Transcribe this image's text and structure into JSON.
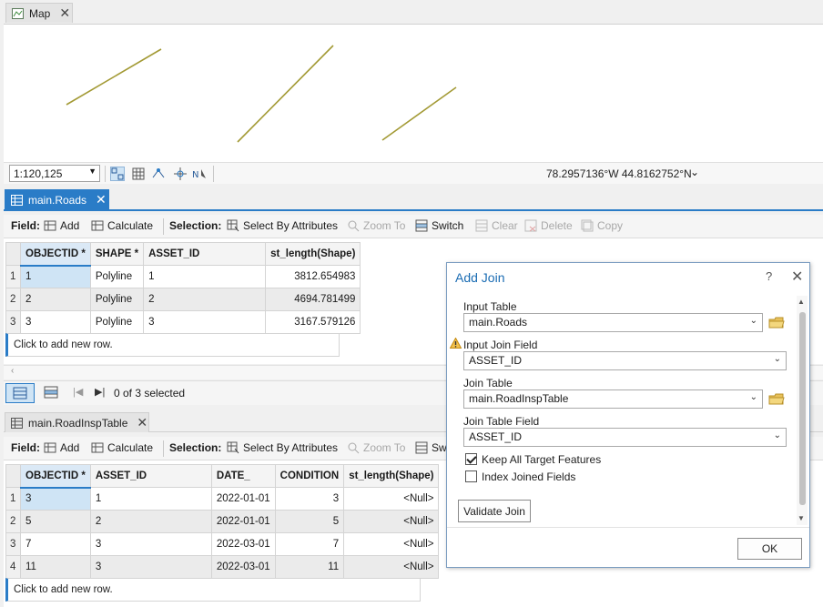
{
  "map_tab": {
    "label": "Map"
  },
  "map_status": {
    "scale": "1:120,125",
    "coordinates": "78.2957136°W 44.8162752°N"
  },
  "roads_tab": {
    "label": "main.Roads"
  },
  "insp_tab": {
    "label": "main.RoadInspTable"
  },
  "toolbar": {
    "field_label": "Field:",
    "add": "Add",
    "calculate": "Calculate",
    "selection_label": "Selection:",
    "select_by_attributes": "Select By Attributes",
    "zoom_to": "Zoom To",
    "switch": "Switch",
    "clear": "Clear",
    "delete": "Delete",
    "copy": "Copy",
    "switch_truncated": "Sw"
  },
  "roads_table": {
    "columns": [
      "OBJECTID *",
      "SHAPE *",
      "ASSET_ID",
      "st_length(Shape)"
    ],
    "rows": [
      {
        "n": "1",
        "cells": [
          "1",
          "Polyline",
          "1",
          "3812.654983"
        ]
      },
      {
        "n": "2",
        "cells": [
          "2",
          "Polyline",
          "2",
          "4694.781499"
        ]
      },
      {
        "n": "3",
        "cells": [
          "3",
          "Polyline",
          "3",
          "3167.579126"
        ]
      }
    ],
    "add_row": "Click to add new row.",
    "selected_status": "0 of 3 selected"
  },
  "insp_table": {
    "columns": [
      "OBJECTID *",
      "ASSET_ID",
      "DATE_",
      "CONDITION",
      "st_length(Shape)"
    ],
    "rows": [
      {
        "n": "1",
        "cells": [
          "3",
          "1",
          "2022-01-01",
          "3",
          "<Null>"
        ]
      },
      {
        "n": "2",
        "cells": [
          "5",
          "2",
          "2022-01-01",
          "5",
          "<Null>"
        ]
      },
      {
        "n": "3",
        "cells": [
          "7",
          "3",
          "2022-03-01",
          "7",
          "<Null>"
        ]
      },
      {
        "n": "4",
        "cells": [
          "11",
          "3",
          "2022-03-01",
          "11",
          "<Null>"
        ]
      }
    ],
    "add_row": "Click to add new row."
  },
  "dialog": {
    "title": "Add Join",
    "help": "?",
    "close": "✕",
    "input_table_label": "Input Table",
    "input_table_value": "main.Roads",
    "input_join_field_label": "Input Join Field",
    "input_join_field_value": "ASSET_ID",
    "join_table_label": "Join Table",
    "join_table_value": "main.RoadInspTable",
    "join_table_field_label": "Join Table Field",
    "join_table_field_value": "ASSET_ID",
    "keep_all_label": "Keep All Target Features",
    "keep_all_checked": true,
    "index_label": "Index Joined Fields",
    "index_checked": false,
    "validate_button": "Validate Join",
    "ok_button": "OK"
  },
  "colors": {
    "accent": "#2a7cc7",
    "road_line": "#a39a35",
    "warning": "#e8a317"
  }
}
